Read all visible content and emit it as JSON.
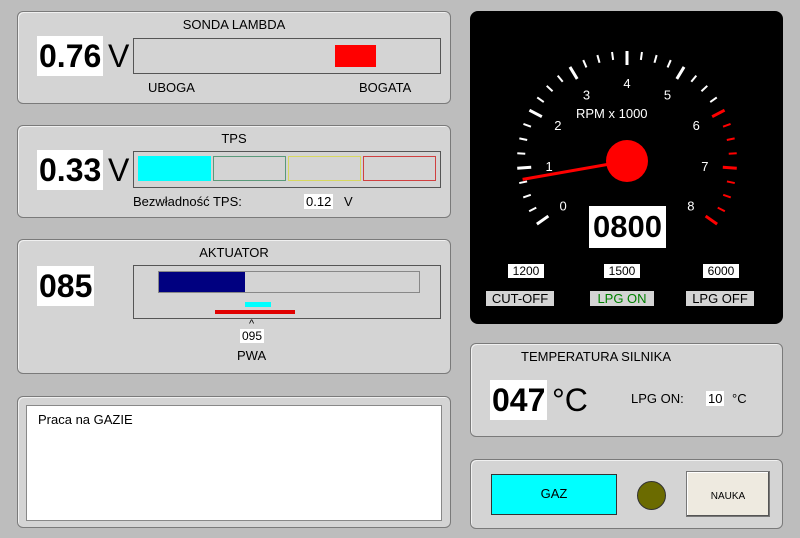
{
  "lambda": {
    "title": "SONDA LAMBDA",
    "value": "0.76",
    "unit": "V",
    "lean_label": "UBOGA",
    "rich_label": "BOGATA",
    "indicator_color": "#ff0000"
  },
  "tps": {
    "title": "TPS",
    "value": "0.33",
    "unit": "V",
    "deadband_label": "Bezwładność TPS:",
    "deadband_value": "0.12",
    "deadband_unit": "V",
    "segment_colors": [
      "#00ffff",
      "#5a9a7a",
      "#d8d860",
      "#d04040"
    ]
  },
  "actuator": {
    "title": "AKTUATOR",
    "value": "085",
    "position_fraction": 0.33,
    "pwa_marker": "^",
    "pwa_value": "095",
    "pwa_label": "PWA",
    "bar_color": "#000080",
    "marker_color": "#00ffff",
    "base_color": "#e00000"
  },
  "message": {
    "text": "Praca na GAZIE"
  },
  "rpm": {
    "label": "RPM x 1000",
    "value": "0800",
    "ticks": [
      "0",
      "1",
      "2",
      "3",
      "4",
      "5",
      "6",
      "7",
      "8"
    ],
    "max": 8,
    "current": 0.8,
    "cutoff_value": "1200",
    "cutoff_label": "CUT-OFF",
    "lpg_on_value": "1500",
    "lpg_on_label": "LPG ON",
    "lpg_off_value": "6000",
    "lpg_off_label": "LPG OFF",
    "needle_color": "#ff0000",
    "redline_color": "#ff0000",
    "lpg_on_color": "#008000"
  },
  "temperature": {
    "title": "TEMPERATURA SILNIKA",
    "value": "047",
    "unit": "°C",
    "lpg_on_label": "LPG ON:",
    "lpg_on_value": "10",
    "lpg_on_unit": "°C"
  },
  "controls": {
    "gas_button": "GAZ",
    "learn_button": "NAUKA",
    "gas_color": "#00ffff",
    "led_color": "#6b6b00"
  }
}
